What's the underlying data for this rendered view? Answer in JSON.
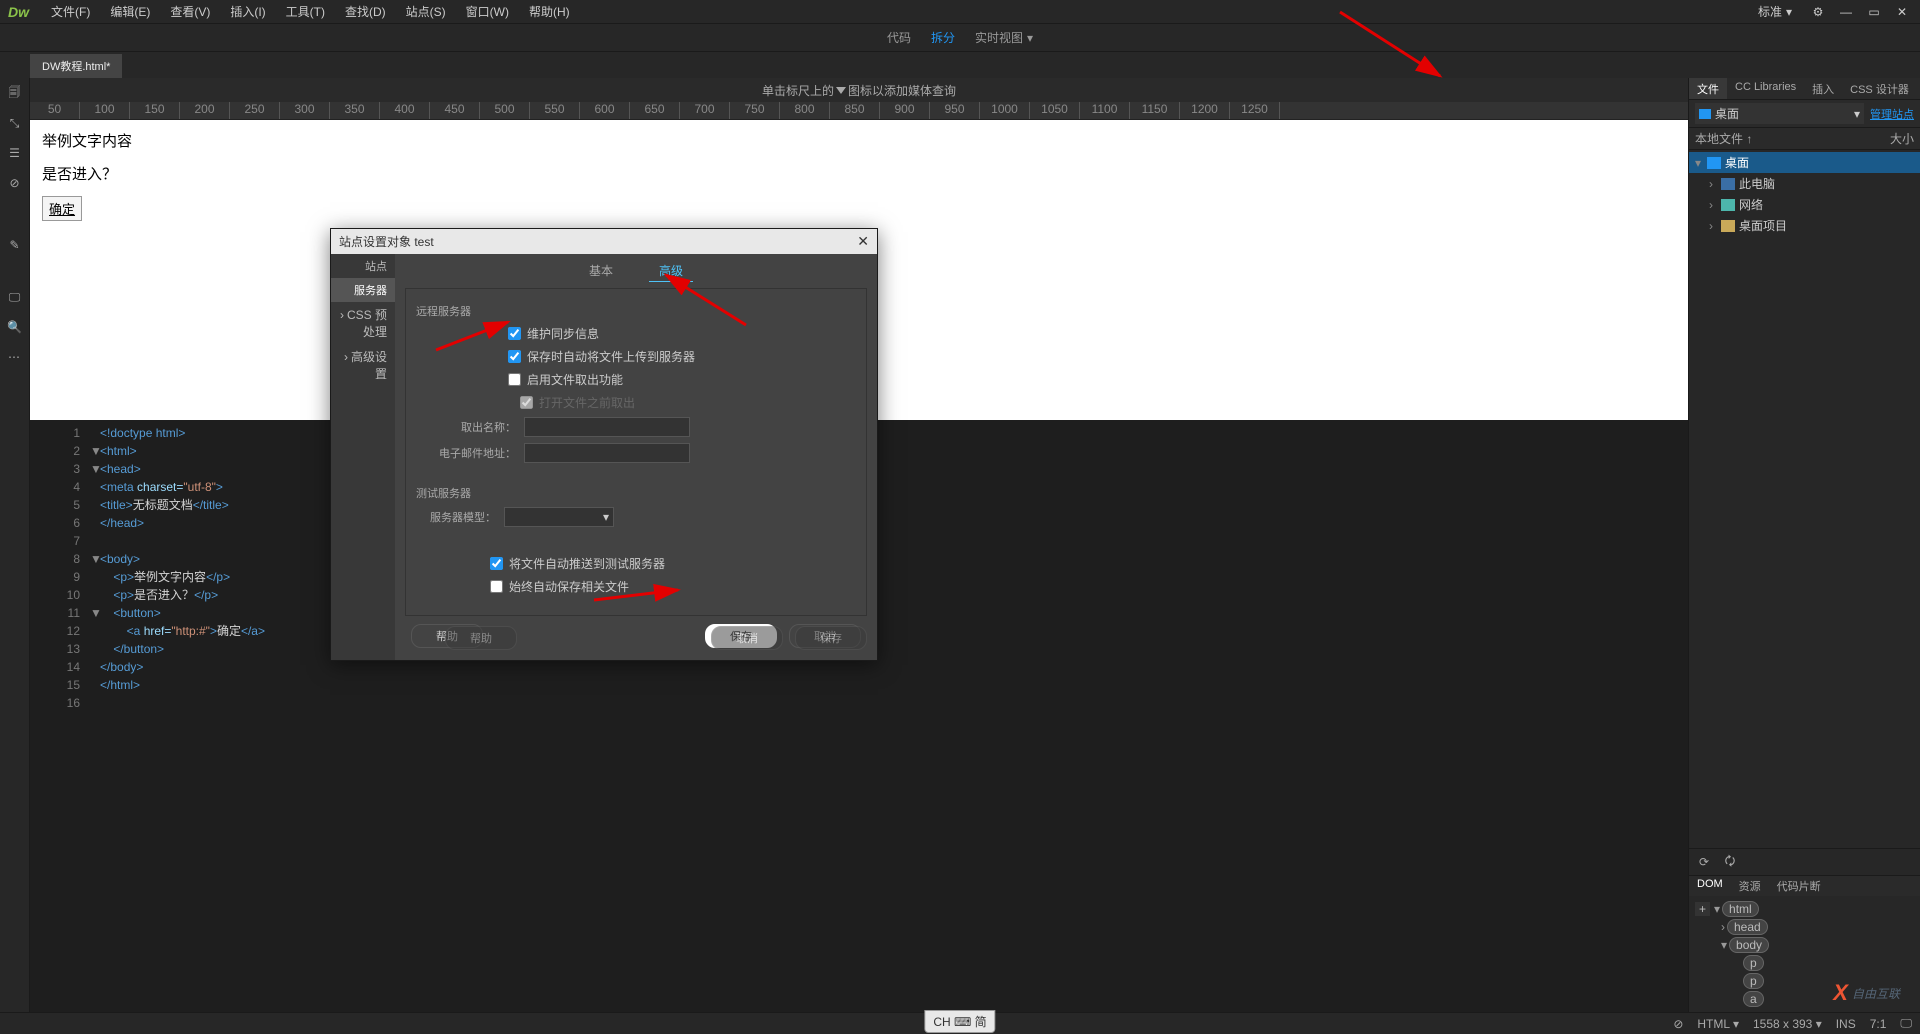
{
  "app": {
    "logo": "Dw"
  },
  "menubar": {
    "items": [
      "文件(F)",
      "编辑(E)",
      "查看(V)",
      "插入(I)",
      "工具(T)",
      "查找(D)",
      "站点(S)",
      "窗口(W)",
      "帮助(H)"
    ],
    "layout": "标准"
  },
  "views": {
    "code": "代码",
    "split": "拆分",
    "live": "实时视图"
  },
  "doctab": "DW教程.html*",
  "media_hint_prefix": "单击标尺上的",
  "media_hint_suffix": "图标以添加媒体查询",
  "ruler_ticks": [
    50,
    100,
    150,
    200,
    250,
    300,
    350,
    400,
    450,
    500,
    550,
    600,
    650,
    700,
    750,
    800,
    850,
    900,
    950,
    1000,
    1050,
    1100,
    1150,
    1200,
    1250
  ],
  "design": {
    "p1": "举例文字内容",
    "p2": "是否进入？",
    "btn": "确定"
  },
  "code_lines": [
    {
      "n": 1,
      "fold": "",
      "html": "<span class='tag'>&lt;!doctype html&gt;</span>"
    },
    {
      "n": 2,
      "fold": "▼",
      "html": "<span class='tag'>&lt;html&gt;</span>"
    },
    {
      "n": 3,
      "fold": "▼",
      "html": "<span class='tag'>&lt;head&gt;</span>"
    },
    {
      "n": 4,
      "fold": "",
      "html": "<span class='tag'>&lt;meta</span> <span class='attr'>charset=</span><span class='str'>\"utf-8\"</span><span class='tag'>&gt;</span>"
    },
    {
      "n": 5,
      "fold": "",
      "html": "<span class='tag'>&lt;title&gt;</span><span class='txt'>无标题文档</span><span class='tag'>&lt;/title&gt;</span>"
    },
    {
      "n": 6,
      "fold": "",
      "html": "<span class='tag'>&lt;/head&gt;</span>"
    },
    {
      "n": 7,
      "fold": "",
      "html": ""
    },
    {
      "n": 8,
      "fold": "▼",
      "html": "<span class='tag'>&lt;body&gt;</span>"
    },
    {
      "n": 9,
      "fold": "",
      "html": "    <span class='tag'>&lt;p&gt;</span><span class='txt'>举例文字内容</span><span class='tag'>&lt;/p&gt;</span>"
    },
    {
      "n": 10,
      "fold": "",
      "html": "    <span class='tag'>&lt;p&gt;</span><span class='txt'>是否进入？</span><span class='tag'>&lt;/p&gt;</span>"
    },
    {
      "n": 11,
      "fold": "▼",
      "html": "    <span class='tag'>&lt;button&gt;</span>"
    },
    {
      "n": 12,
      "fold": "",
      "html": "        <span class='tag'>&lt;a</span> <span class='attr'>href=</span><span class='str'>\"http:#\"</span><span class='tag'>&gt;</span><span class='txt'>确定</span><span class='tag'>&lt;/a&gt;</span>"
    },
    {
      "n": 13,
      "fold": "",
      "html": "    <span class='tag'>&lt;/button&gt;</span>"
    },
    {
      "n": 14,
      "fold": "",
      "html": "<span class='tag'>&lt;/body&gt;</span>"
    },
    {
      "n": 15,
      "fold": "",
      "html": "<span class='tag'>&lt;/html&gt;</span>"
    },
    {
      "n": 16,
      "fold": "",
      "html": ""
    }
  ],
  "files_panel": {
    "tabs": [
      "文件",
      "CC Libraries",
      "插入",
      "CSS 设计器"
    ],
    "site_selected": "桌面",
    "manage": "管理站点",
    "header_local": "本地文件 ↑",
    "header_size": "大小",
    "tree": [
      {
        "icon": "ico-desktop",
        "label": "桌面",
        "sel": true,
        "indent": 0,
        "exp": "▾"
      },
      {
        "icon": "ico-pc",
        "label": "此电脑",
        "indent": 1,
        "exp": "›"
      },
      {
        "icon": "ico-net",
        "label": "网络",
        "indent": 1,
        "exp": "›"
      },
      {
        "icon": "ico-folder",
        "label": "桌面项目",
        "indent": 1,
        "exp": "›"
      }
    ]
  },
  "dom_panel": {
    "tabs": [
      "DOM",
      "资源",
      "代码片断"
    ],
    "rows": [
      "html",
      "head",
      "body",
      "p",
      "p",
      "a"
    ]
  },
  "dialog": {
    "title": "站点设置对象 test",
    "sidebar": [
      "站点",
      "服务器",
      "CSS 预处理",
      "高级设置"
    ],
    "sidebar_active": 1,
    "tabs": {
      "basic": "基本",
      "advanced": "高级"
    },
    "remote_label": "远程服务器",
    "chk_sync": "维护同步信息",
    "chk_upload": "保存时自动将文件上传到服务器",
    "chk_checkout": "启用文件取出功能",
    "chk_open_checkout": "打开文件之前取出",
    "field_checkout_name": "取出名称：",
    "field_email": "电子邮件地址：",
    "test_label": "测试服务器",
    "field_model": "服务器模型：",
    "chk_push": "将文件自动推送到测试服务器",
    "chk_autosave": "始终自动保存相关文件",
    "btn_help": "帮助",
    "btn_save": "保存",
    "btn_cancel": "取消",
    "behind_help": "帮助",
    "behind_cancel": "取消",
    "behind_save": "保存"
  },
  "statusbar": {
    "lang_pill": "CH ⌨ 简",
    "odiv": "⊘",
    "html_mode": "HTML",
    "dims": "1558 x 393",
    "ins": "INS",
    "pos": "7:1"
  },
  "watermark": "自由互联"
}
